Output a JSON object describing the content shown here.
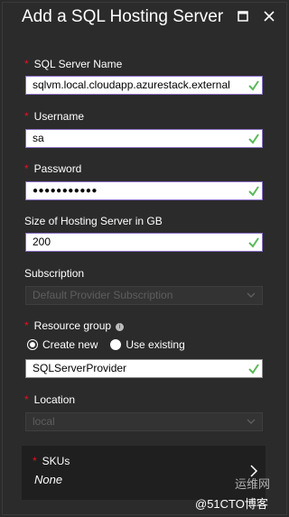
{
  "blade": {
    "title": "Add a SQL Hosting Server"
  },
  "fields": {
    "server_name": {
      "label": "SQL Server Name",
      "value": "sqlvm.local.cloudapp.azurestack.external",
      "required": "*"
    },
    "username": {
      "label": "Username",
      "value": "sa",
      "required": "*"
    },
    "password": {
      "label": "Password",
      "value": "●●●●●●●●●●●",
      "required": "*"
    },
    "size": {
      "label": "Size of Hosting Server in GB",
      "value": "200"
    },
    "subscription": {
      "label": "Subscription",
      "value": "Default Provider Subscription"
    },
    "resource_group": {
      "label": "Resource group",
      "required": "*",
      "info_icon": "i",
      "option_new": "Create new",
      "option_existing": "Use existing",
      "value": "SQLServerProvider"
    },
    "location": {
      "label": "Location",
      "value": "local",
      "required": "*"
    },
    "skus": {
      "label": "SKUs",
      "value": "None",
      "required": "*"
    }
  },
  "watermark": {
    "top": "运维网",
    "bottom": "@51CTO博客"
  },
  "colors": {
    "background": "#2b2b2b",
    "field_border": "#8a6fc4",
    "check_green": "#5cb85c",
    "required_red": "#e81123"
  }
}
